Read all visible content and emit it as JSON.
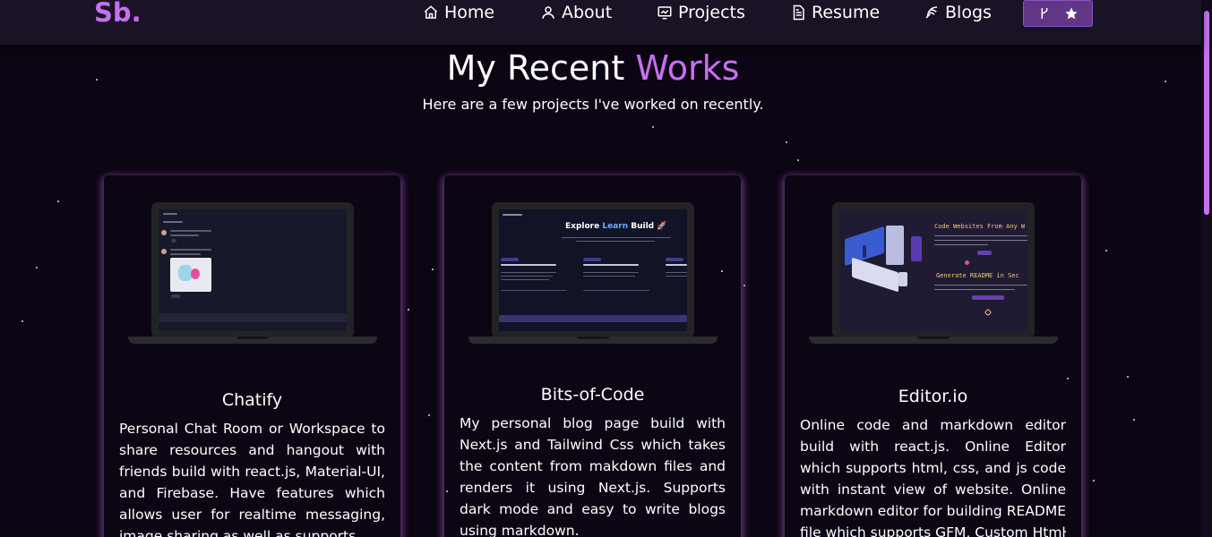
{
  "navbar": {
    "logo": "Sb.",
    "links": [
      {
        "label": "Home",
        "icon": "home-icon"
      },
      {
        "label": "About",
        "icon": "user-icon"
      },
      {
        "label": "Projects",
        "icon": "projects-icon"
      },
      {
        "label": "Resume",
        "icon": "document-icon"
      },
      {
        "label": "Blogs",
        "icon": "feather-icon"
      }
    ],
    "github_button": {
      "icons": [
        "git-fork-icon",
        "star-icon"
      ]
    }
  },
  "section": {
    "title_part1": "My Recent ",
    "title_part2": "Works",
    "subtitle": "Here are a few projects I've worked on recently."
  },
  "projects": [
    {
      "title": "Chatify",
      "description": "Personal Chat Room or Workspace to share resources and hangout with friends build with react.js, Material-UI, and Firebase. Have features which allows user for realtime messaging, image sharing as well as supports"
    },
    {
      "title": "Bits-of-Code",
      "description": "My personal blog page build with Next.js and Tailwind Css which takes the content from makdown files and renders it using Next.js. Supports dark mode and easy to write blogs using markdown.",
      "screen_heading_1": "Explore ",
      "screen_heading_2": "Learn",
      "screen_heading_3": " Build"
    },
    {
      "title": "Editor.io",
      "description": "Online code and markdown editor build with react.js. Online Editor which supports html, css, and js code with instant view of website. Online markdown editor for building README file which supports GFM, Custom Html",
      "screen_line_1": "Code Websites From Any W",
      "screen_line_2": "Generate README in Sec"
    }
  ],
  "colors": {
    "accent": "#c770f0",
    "background": "#0c0513",
    "navbar": "#1a1326"
  }
}
